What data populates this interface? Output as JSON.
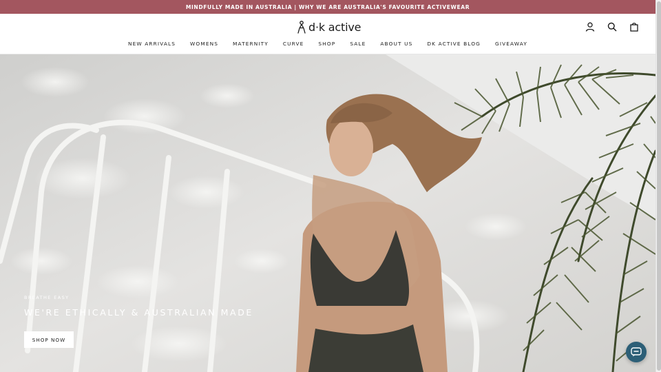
{
  "announcement": {
    "text": "MINDFULLY MADE IN AUSTRALIA | WHY WE ARE AUSTRALIA'S FAVOURITE ACTIVEWEAR"
  },
  "brand": {
    "name": "d·k active"
  },
  "nav": {
    "items": [
      {
        "label": "NEW ARRIVALS"
      },
      {
        "label": "WOMENS"
      },
      {
        "label": "MATERNITY"
      },
      {
        "label": "CURVE"
      },
      {
        "label": "SHOP"
      },
      {
        "label": "SALE"
      },
      {
        "label": "ABOUT US"
      },
      {
        "label": "DK ACTIVE BLOG"
      },
      {
        "label": "GIVEAWAY"
      }
    ]
  },
  "header_icons": [
    "account-icon",
    "search-icon",
    "bag-icon"
  ],
  "hero": {
    "eyebrow": "BREATHE EASY",
    "heading": "WE'RE ETHICALLY & AUSTRALIAN MADE",
    "cta_label": "SHOP NOW"
  },
  "chat": {
    "icon": "chat-icon"
  },
  "colors": {
    "announcement_bg": "#a3565f",
    "chat_bg": "#2d5f77"
  }
}
